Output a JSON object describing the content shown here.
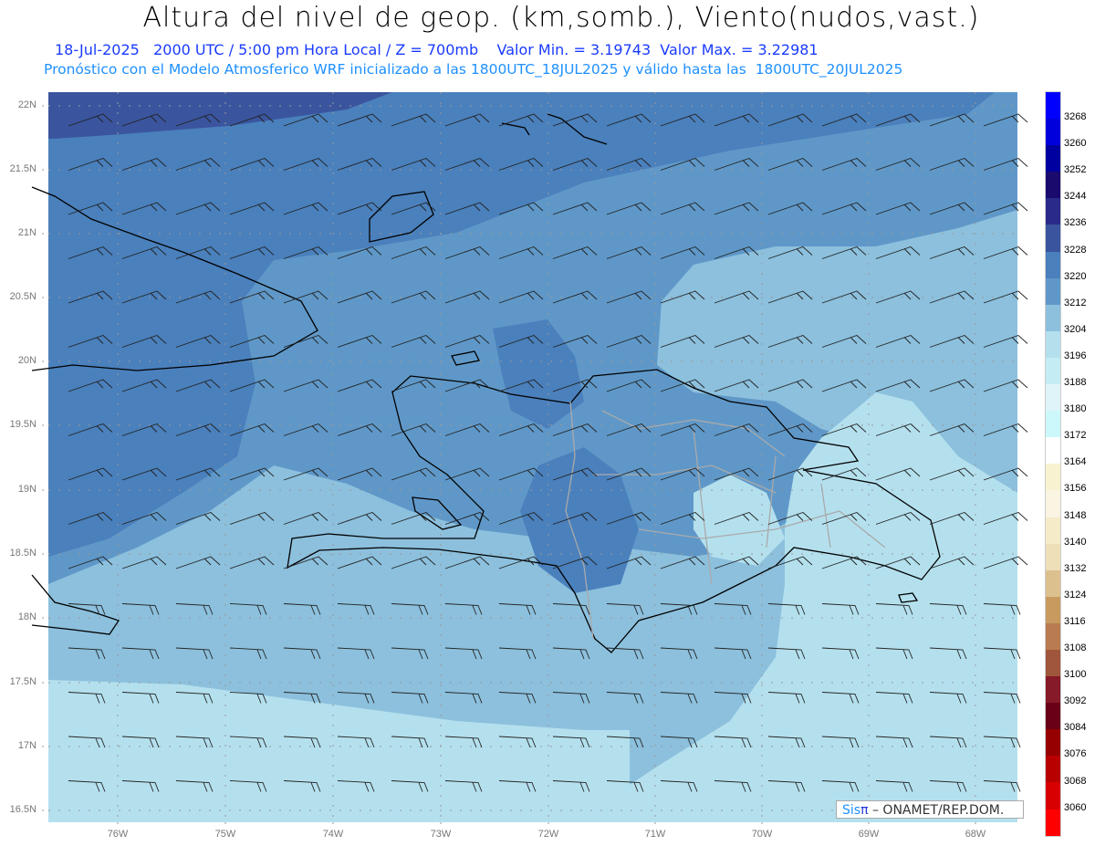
{
  "title": "Altura del nivel de geop. (km,somb.), Viento(nudos,vast.)",
  "subtitle": "18-Jul-2025   2000 UTC / 5:00 pm Hora Local / Z = 700mb    Valor Min. = 3.19743  Valor Max. = 3.22981",
  "model_info": "Pronóstico con el Modelo Atmosferico WRF inicializado a las 1800UTC_18JUL2025 y válido hasta las  1800UTC_20JUL2025",
  "lat_labels": [
    "22N",
    "21.5N",
    "21N",
    "20.5N",
    "20N",
    "19.5N",
    "19N",
    "18.5N",
    "18N",
    "17.5N",
    "17N",
    "16.5N"
  ],
  "lon_labels": [
    "76W",
    "75W",
    "74W",
    "73W",
    "72W",
    "71W",
    "70W",
    "69W",
    "68W"
  ],
  "colorbar": {
    "labels": [
      "3268",
      "3260",
      "3252",
      "3244",
      "3236",
      "3228",
      "3220",
      "3212",
      "3204",
      "3196",
      "3188",
      "3180",
      "3172",
      "3164",
      "3156",
      "3148",
      "3140",
      "3132",
      "3124",
      "3116",
      "3108",
      "3100",
      "3092",
      "3084",
      "3076",
      "3068",
      "3060"
    ],
    "colors": [
      "#0000ff",
      "#0000dd",
      "#0000a0",
      "#1a0a6e",
      "#2a2a8a",
      "#3a559e",
      "#4a80bc",
      "#5f98c8",
      "#8cc0dd",
      "#b4e0ee",
      "#c4ecf4",
      "#dff4f8",
      "#ccf8fb",
      "#ffffff",
      "#f8f2d0",
      "#faf4e2",
      "#f5ebc8",
      "#eedfb8",
      "#dcc08e",
      "#c89a60",
      "#b87c50",
      "#a0563c",
      "#861a28",
      "#6a0018",
      "#960000",
      "#b80000",
      "#d80000",
      "#ff0000"
    ]
  },
  "credit": {
    "sis": "Sis",
    "pi": "π",
    "org": "– ONAMET/REP.DOM."
  },
  "fill_colors": {
    "c3228": "#3a559e",
    "c3220": "#4a80bc",
    "c3212": "#5f98c8",
    "c3204": "#8cc0dd",
    "c3196": "#b4e0ee"
  }
}
